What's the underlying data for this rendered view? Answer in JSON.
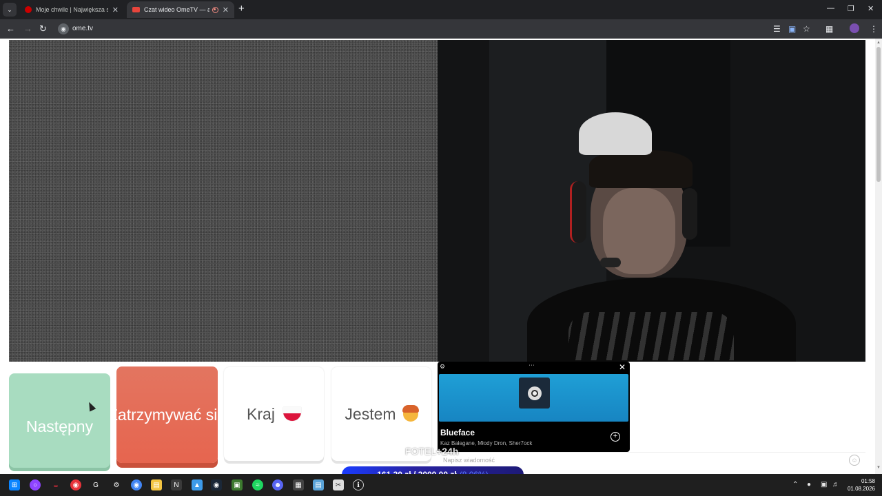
{
  "browser": {
    "tabs": [
      {
        "label": "Moje chwile | Największa strona",
        "active": false
      },
      {
        "label": "Czat wideo OmeTV — alternatywa",
        "active": true
      }
    ],
    "url": "ome.tv"
  },
  "controls": {
    "next_label": "Następny",
    "stop_label": "Zatrzymywać się",
    "country_label": "Kraj",
    "gender_label": "Jestem"
  },
  "chat": {
    "placeholder": "Napisz wiadomość"
  },
  "spotify": {
    "title": "Blueface",
    "artists": "Kaz Bałagane, Młody Dron, Sher7ock"
  },
  "overlay": {
    "fotel_text": "FOTEL",
    "fotel_time": "+24h",
    "donation_current": "161,30 zł",
    "donation_sep": "/",
    "donation_goal": "2000,00 zł",
    "donation_pct": "(8.06%)"
  },
  "taskbar": {
    "time": "01:58",
    "date": "01.08.2026"
  },
  "colors": {
    "next": "#a8dcc0",
    "stop": "#e6654f",
    "spotify_banner": "#1f9fd6",
    "donation_bar": "#1a3cff"
  }
}
